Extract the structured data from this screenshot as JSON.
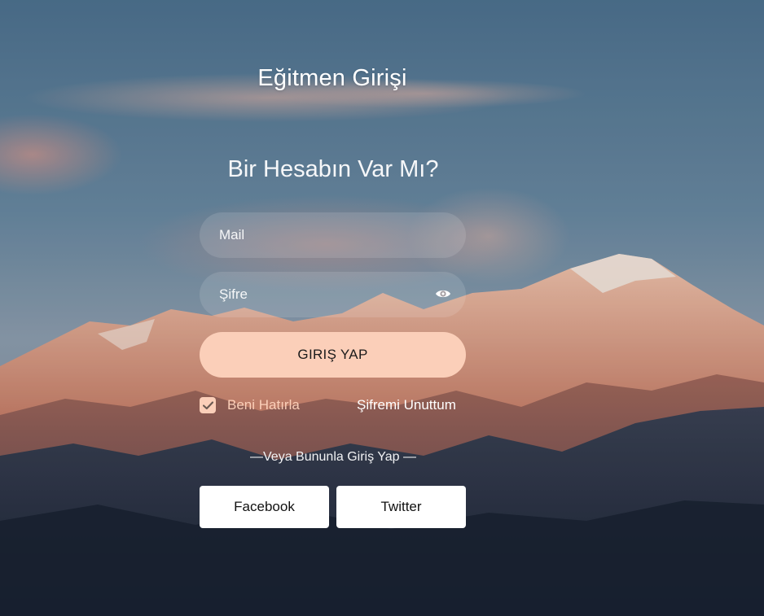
{
  "header": {
    "title": "Eğitmen Girişi",
    "subtitle": "Bir Hesabın Var Mı?"
  },
  "form": {
    "mail_placeholder": "Mail",
    "password_placeholder": "Şifre",
    "password_toggle_icon": "eye-icon",
    "login_label": "GIRIŞ YAP",
    "remember_label": "Beni Hatırla",
    "remember_checked": true,
    "forgot_label": "Şifremi Unuttum"
  },
  "social": {
    "divider_text": "—Veya Bununla Giriş Yap —",
    "facebook_label": "Facebook",
    "twitter_label": "Twitter"
  },
  "colors": {
    "accent": "#fbcfb9",
    "button_text": "#1b1b1b",
    "social_bg": "#ffffff"
  }
}
